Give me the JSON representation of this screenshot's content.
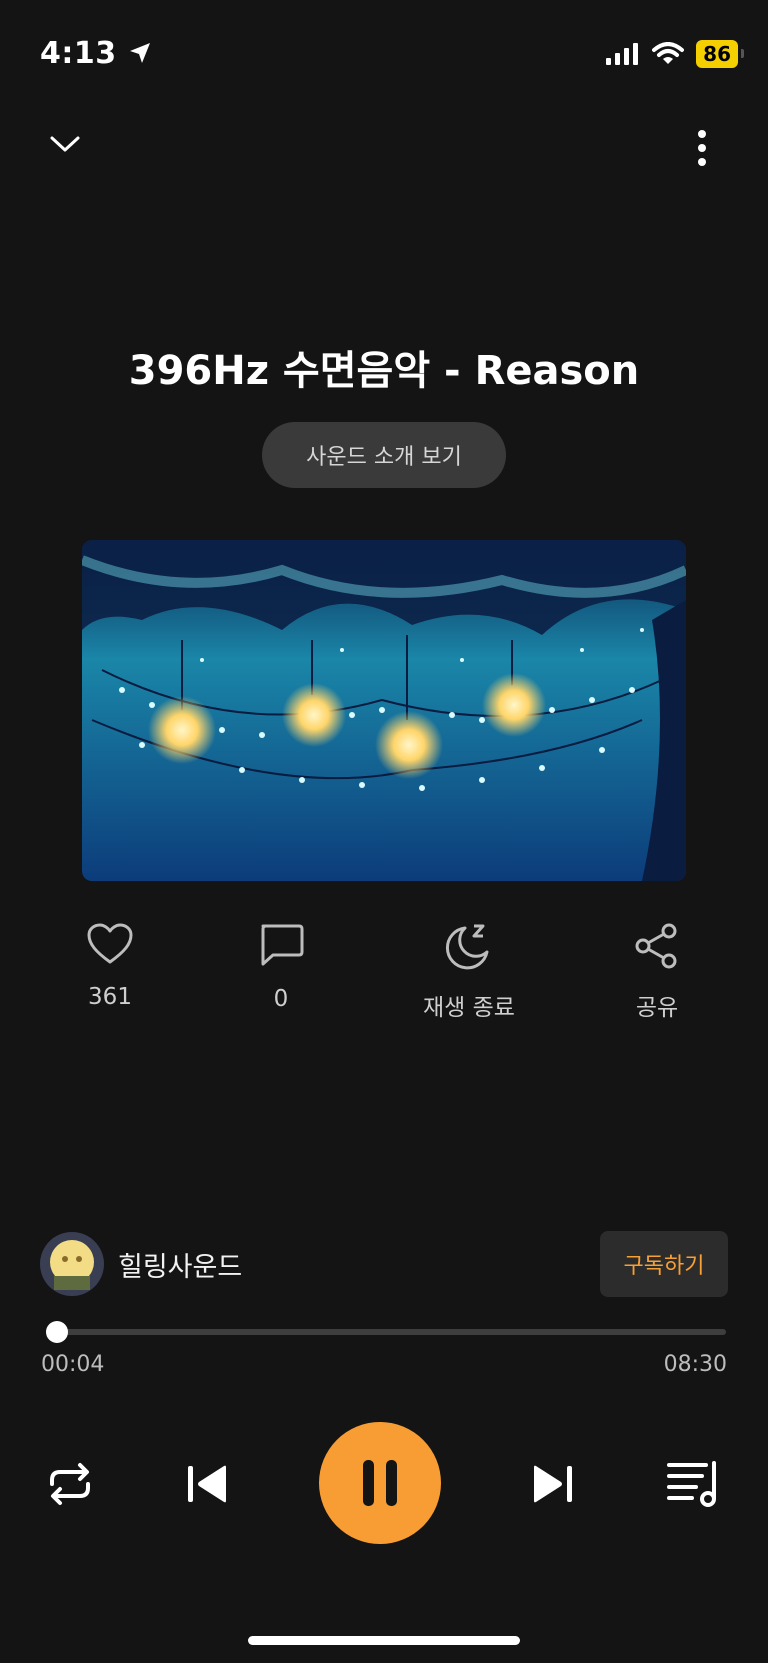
{
  "status_bar": {
    "time": "4:13",
    "battery": "86"
  },
  "track": {
    "title": "396Hz 수면음악 - Reason",
    "info_button": "사운드 소개 보기"
  },
  "actions": {
    "likes": "361",
    "comments": "0",
    "sleep_timer": "재생 종료",
    "share": "공유"
  },
  "artist": {
    "name": "힐링사운드",
    "subscribe": "구독하기"
  },
  "player": {
    "elapsed": "00:04",
    "duration": "08:30",
    "progress": 0.008
  },
  "colors": {
    "accent": "#f89d34",
    "background": "#141414"
  }
}
